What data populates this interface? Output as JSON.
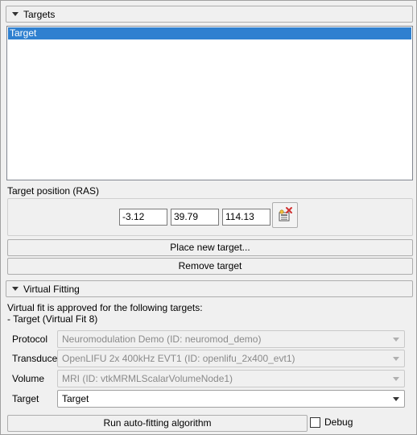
{
  "targets_section": {
    "title": "Targets",
    "items": [
      "Target"
    ],
    "position_label": "Target position (RAS)",
    "coords": {
      "r": "-3.12",
      "a": "39.79",
      "s": "114.13"
    },
    "place_button": "Place new target...",
    "remove_button": "Remove target"
  },
  "virtual_fitting": {
    "title": "Virtual Fitting",
    "status_line1": "Virtual fit is approved for the following targets:",
    "status_line2": "- Target (Virtual Fit 8)",
    "protocol_label": "Protocol",
    "protocol_value": "Neuromodulation Demo (ID: neuromod_demo)",
    "transducer_label": "Transducer",
    "transducer_value": "OpenLIFU 2x 400kHz EVT1 (ID: openlifu_2x400_evt1)",
    "volume_label": "Volume",
    "volume_value": "MRI (ID: vtkMRMLScalarVolumeNode1)",
    "target_label": "Target",
    "target_value": "Target",
    "run_button": "Run auto-fitting algorithm",
    "debug_label": "Debug"
  },
  "colors": {
    "selection": "#2f80d0",
    "delete_x": "#d03030"
  }
}
